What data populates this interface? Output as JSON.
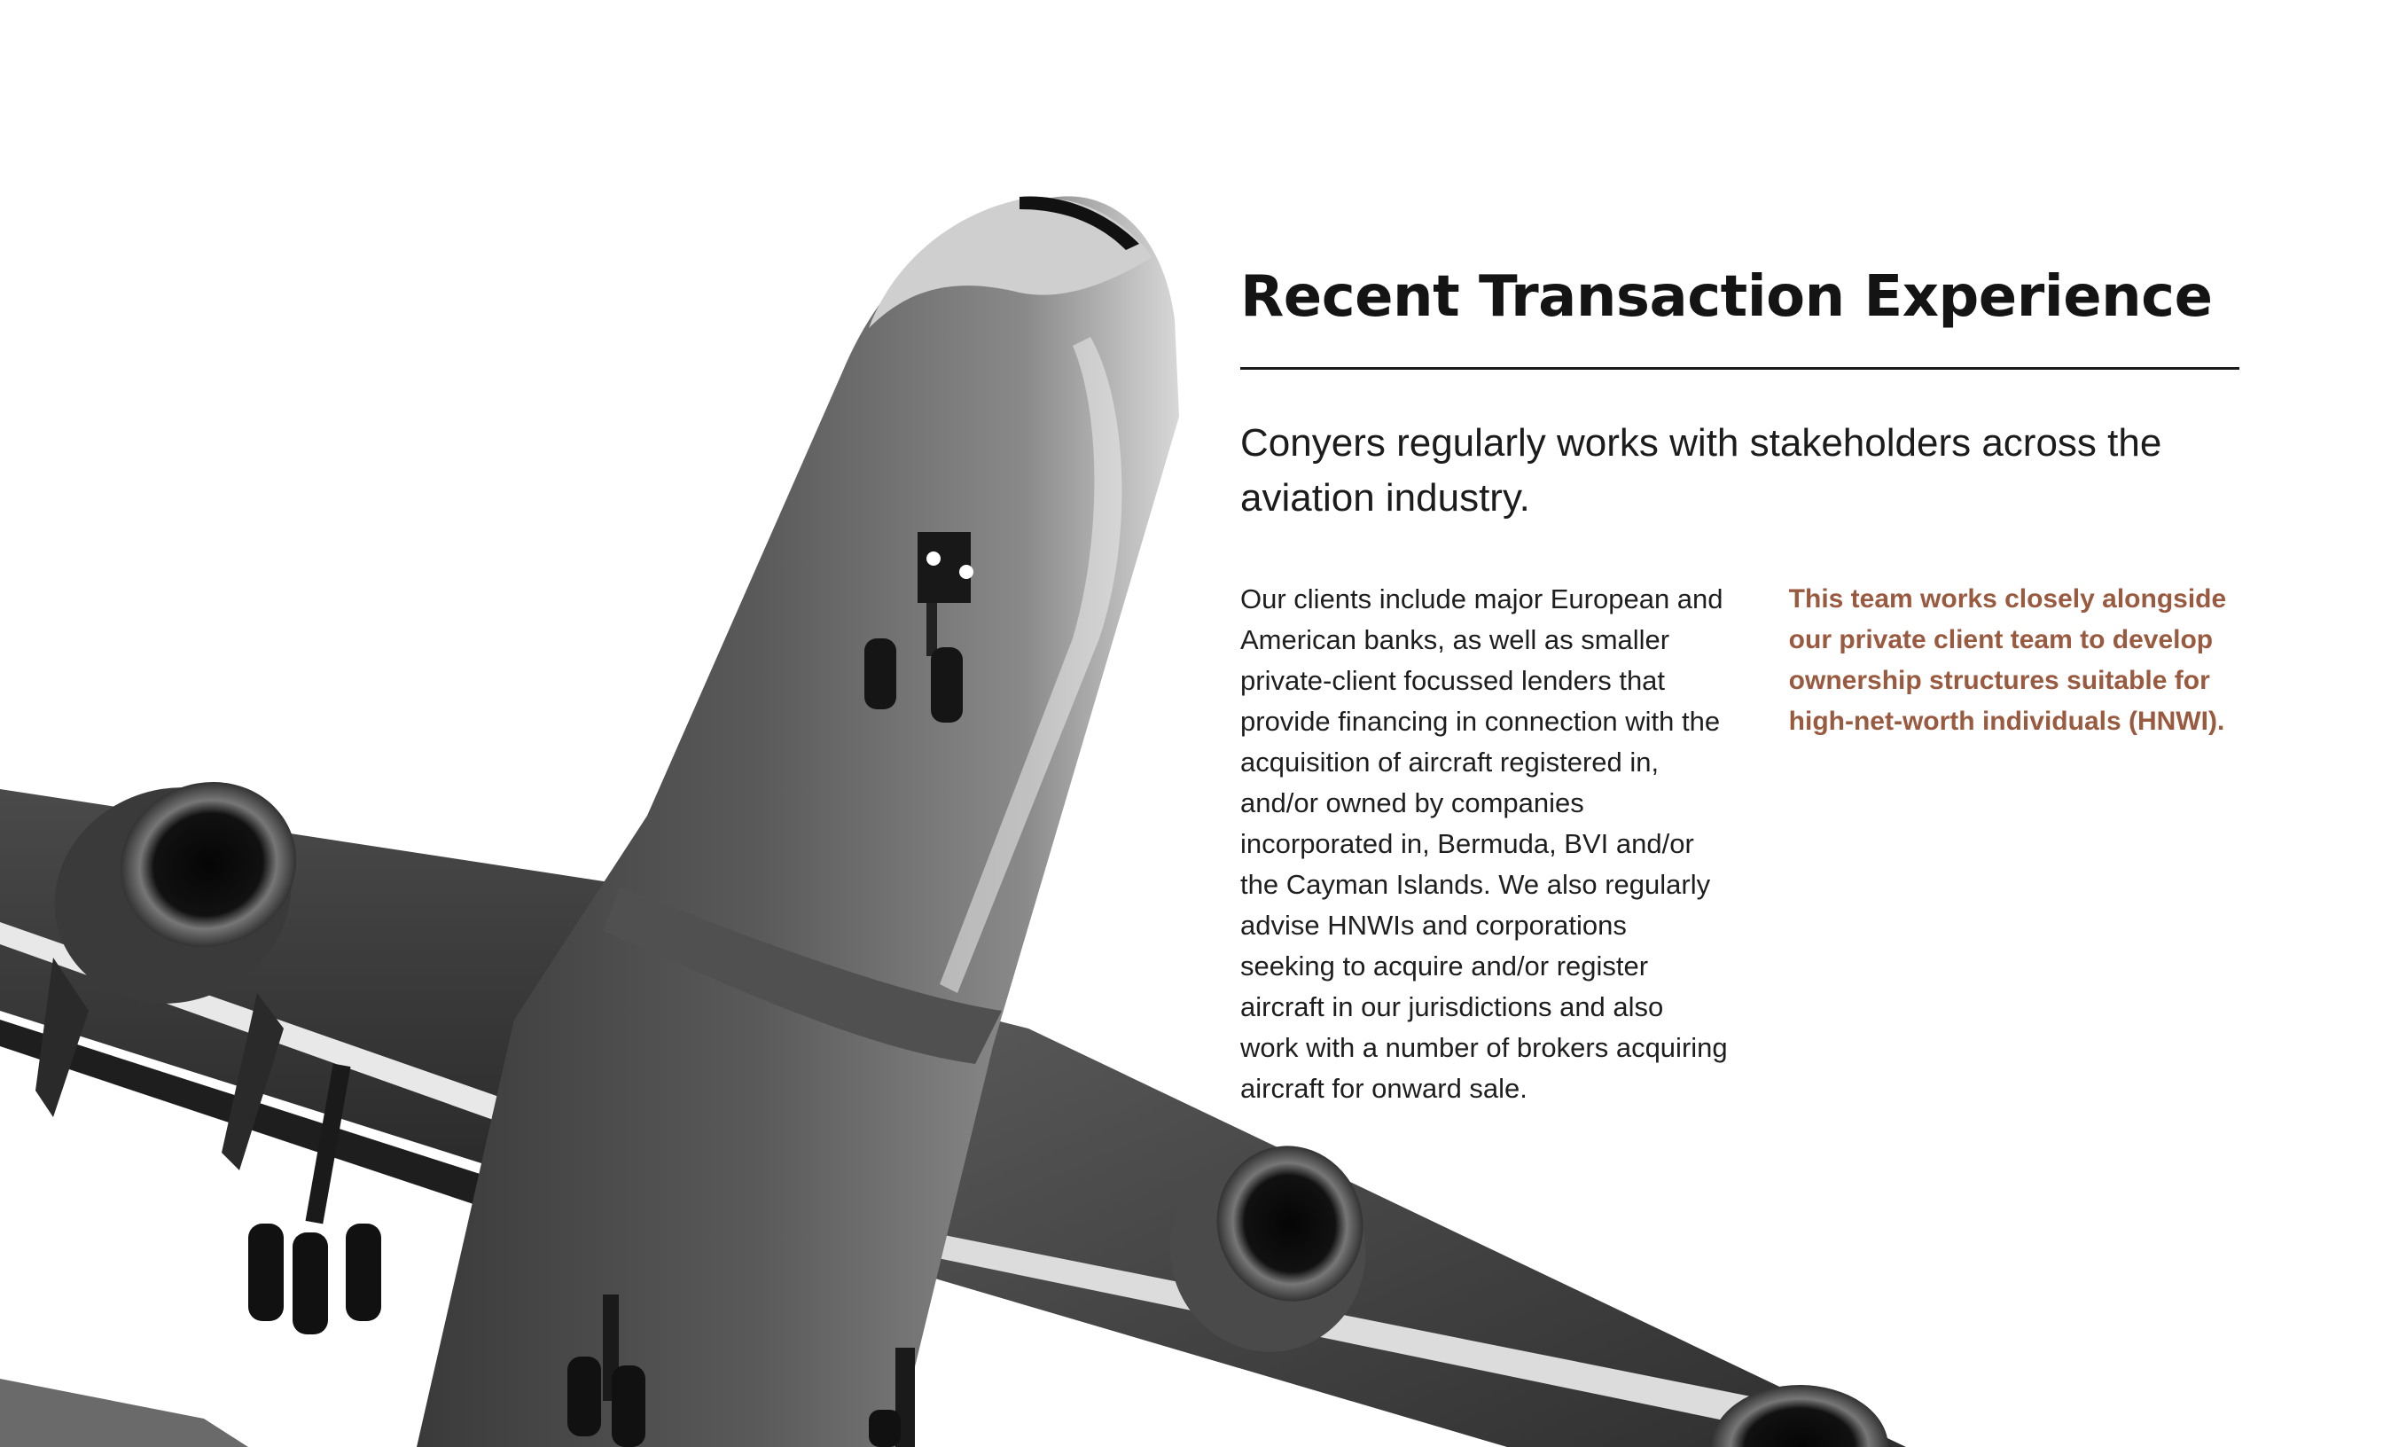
{
  "page": {
    "title": "Recent Transaction Experience",
    "lead": "Conyers regularly works with stakeholders across the aviation industry.",
    "body": "Our clients include major European and American banks, as well as smaller private-client focussed lenders that provide financing in connection with the acquisition of aircraft registered in, and/or owned by companies incorporated in, Bermuda, BVI and/or the Cayman Islands. We also regularly advise HNWIs and corporations seeking to acquire and/or register aircraft in our jurisdictions and also work with a number of brokers acquiring aircraft for onward sale.",
    "callout": "This team works closely alongside our private client team to develop ownership structures suitable for high-net-worth individuals (HNWI)."
  },
  "image": {
    "subject": "airliner-photo",
    "style": "black-and-white"
  },
  "colors": {
    "accent": "#9a5a40",
    "text": "#1a1a1a",
    "background": "#ffffff"
  }
}
